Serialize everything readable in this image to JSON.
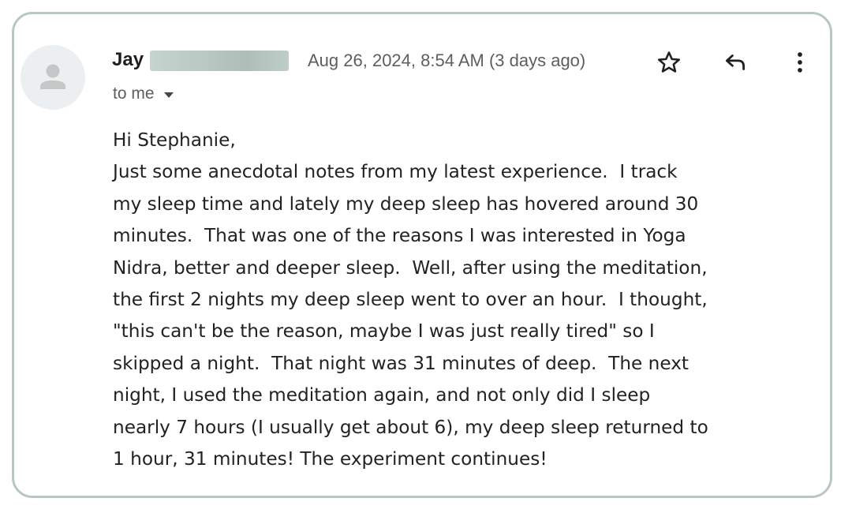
{
  "sender": {
    "name": "Jay",
    "name_redacted": true
  },
  "timestamp": "Aug 26, 2024, 8:54 AM (3 days ago)",
  "recipient": {
    "label": "to me"
  },
  "actions": {
    "star": "star-icon",
    "reply": "reply-icon",
    "more": "more-vert-icon"
  },
  "colors": {
    "border": "#b7c8c2",
    "redaction": "#b4c5bf",
    "avatar_bg": "#eceff1",
    "avatar_fg": "#c4c7c5"
  },
  "body_lines": [
    "Hi Stephanie,",
    "Just some anecdotal notes from my latest experience.  I track",
    "my sleep time and lately my deep sleep has hovered around 30",
    "minutes.  That was one of the reasons I was interested in Yoga",
    "Nidra, better and deeper sleep.  Well, after using the meditation,",
    "the first 2 nights my deep sleep went to over an hour.  I thought,",
    "\"this can't be the reason, maybe I was just really tired\" so I",
    "skipped a night.  That night was 31 minutes of deep.  The next",
    "night, I used the meditation again, and not only did I sleep",
    "nearly 7 hours (I usually get about 6), my deep sleep returned to",
    "1 hour, 31 minutes! The experiment continues!"
  ]
}
